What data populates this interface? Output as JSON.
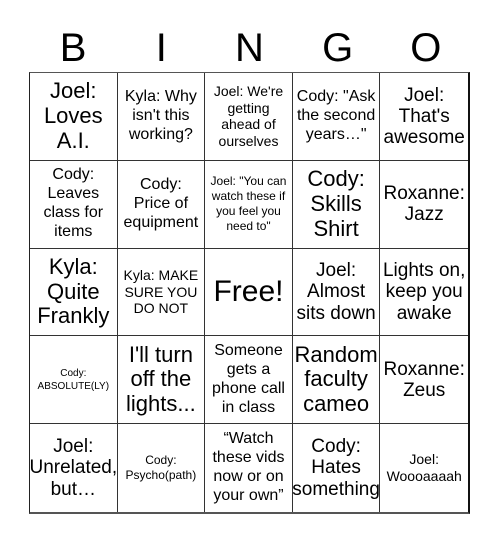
{
  "title_letters": [
    "B",
    "I",
    "N",
    "G",
    "O"
  ],
  "cells": [
    "Joel: Loves A.I.",
    "Kyla: Why isn't this working?",
    "Joel: We're getting ahead of ourselves",
    "Cody: \"Ask the second years…\"",
    "Joel: That's awesome",
    "Cody: Leaves class for items",
    "Cody: Price of equipment",
    "Joel: \"You can watch these if you feel you need to\"",
    "Cody: Skills Shirt",
    "Roxanne: Jazz",
    "Kyla: Quite Frankly",
    "Kyla: MAKE SURE YOU DO NOT",
    "Free!",
    "Joel: Almost sits down",
    "Lights on, keep you awake",
    "Cody: ABSOLUTE(LY)",
    "I'll turn off the lights...",
    "Someone gets a phone call in class",
    "Random faculty cameo",
    "Roxanne: Zeus",
    "Joel: Unrelated, but…",
    "Cody: Psycho(path)",
    "“Watch these vids now or on your own”",
    "Cody: Hates something",
    "Joel: Woooaaaah"
  ]
}
